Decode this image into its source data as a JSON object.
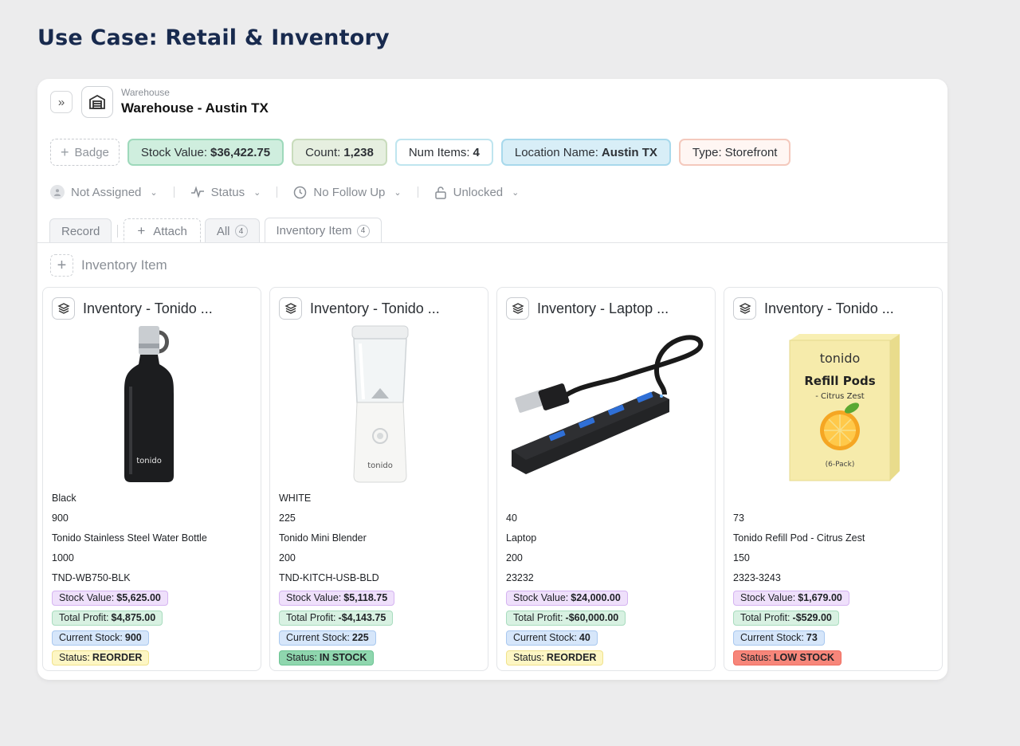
{
  "page_heading": "Use Case: Retail & Inventory",
  "record": {
    "type_label": "Warehouse",
    "title": "Warehouse - Austin TX",
    "icon": "garage-icon"
  },
  "badges": {
    "add_label": "Badge",
    "stock_value": {
      "label": "Stock Value:",
      "value": "$36,422.75"
    },
    "count": {
      "label": "Count:",
      "value": "1,238"
    },
    "num_items": {
      "label": "Num Items:",
      "value": "4"
    },
    "location": {
      "label": "Location Name:",
      "value": "Austin TX"
    },
    "type": {
      "label": "Type:",
      "value": "Storefront"
    }
  },
  "filters": {
    "assignee": "Not Assigned",
    "status": "Status",
    "follow_up": "No Follow Up",
    "lock": "Unlocked"
  },
  "tabs": {
    "record": "Record",
    "attach": "Attach",
    "all": {
      "label": "All",
      "count": "4"
    },
    "inventory_item": {
      "label": "Inventory Item",
      "count": "4"
    }
  },
  "section": {
    "add_label": "Inventory Item"
  },
  "cards": [
    {
      "title": "Inventory - Tonido ...",
      "image": "water-bottle",
      "lines": [
        "Black",
        "900",
        "Tonido Stainless Steel Water Bottle",
        "1000",
        "TND-WB750-BLK"
      ],
      "stock_value": {
        "label": "Stock Value:",
        "value": "$5,625.00"
      },
      "total_profit": {
        "label": "Total Profit:",
        "value": "$4,875.00"
      },
      "current_stock": {
        "label": "Current Stock:",
        "value": "900"
      },
      "status": {
        "label": "Status:",
        "value": "REORDER"
      }
    },
    {
      "title": "Inventory - Tonido ...",
      "image": "blender",
      "lines": [
        "WHITE",
        "225",
        "Tonido Mini Blender",
        "200",
        "TND-KITCH-USB-BLD"
      ],
      "stock_value": {
        "label": "Stock Value:",
        "value": "$5,118.75"
      },
      "total_profit": {
        "label": "Total Profit:",
        "value": "-$4,143.75"
      },
      "current_stock": {
        "label": "Current Stock:",
        "value": "225"
      },
      "status": {
        "label": "Status:",
        "value": "IN STOCK"
      }
    },
    {
      "title": "Inventory - Laptop ...",
      "image": "usb-hub",
      "lines": [
        "40",
        "Laptop",
        "200",
        "23232"
      ],
      "stock_value": {
        "label": "Stock Value:",
        "value": "$24,000.00"
      },
      "total_profit": {
        "label": "Total Profit:",
        "value": "-$60,000.00"
      },
      "current_stock": {
        "label": "Current Stock:",
        "value": "40"
      },
      "status": {
        "label": "Status:",
        "value": "REORDER"
      }
    },
    {
      "title": "Inventory - Tonido ...",
      "image": "refill-pods-box",
      "image_text": {
        "brand": "tonido",
        "line1": "Refill Pods",
        "line2": "- Citrus Zest",
        "line3": "(6-Pack)"
      },
      "lines": [
        "73",
        "Tonido Refill Pod - Citrus Zest",
        "150",
        "2323-3243"
      ],
      "stock_value": {
        "label": "Stock Value:",
        "value": "$1,679.00"
      },
      "total_profit": {
        "label": "Total Profit:",
        "value": "-$529.00"
      },
      "current_stock": {
        "label": "Current Stock:",
        "value": "73"
      },
      "status": {
        "label": "Status:",
        "value": "LOW STOCK"
      }
    }
  ],
  "product_brand_mark": "tonido"
}
